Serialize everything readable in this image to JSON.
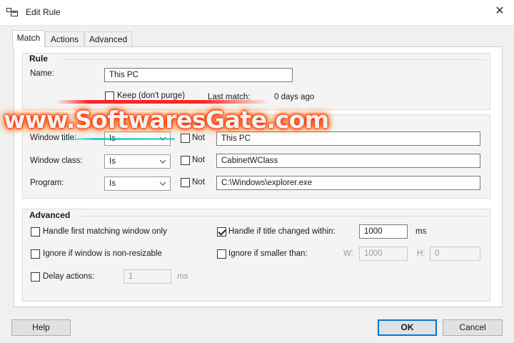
{
  "window": {
    "title": "Edit Rule",
    "close_glyph": "✕"
  },
  "tabs": [
    {
      "label": "Match",
      "active": true
    },
    {
      "label": "Actions",
      "active": false
    },
    {
      "label": "Advanced",
      "active": false
    }
  ],
  "rule": {
    "title": "Rule",
    "name_label": "Name:",
    "name_value": "This PC",
    "keep_label": "Keep (don't purge)",
    "keep_checked": false,
    "last_match_label": "Last match:",
    "last_match_value": "0 days ago"
  },
  "match_rows": [
    {
      "label": "Window title:",
      "operator": "Is",
      "not_label": "Not",
      "not_checked": false,
      "value": "This PC"
    },
    {
      "label": "Window class:",
      "operator": "Is",
      "not_label": "Not",
      "not_checked": false,
      "value": "CabinetWClass"
    },
    {
      "label": "Program:",
      "operator": "Is",
      "not_label": "Not",
      "not_checked": false,
      "value": "C:\\Windows\\explorer.exe"
    }
  ],
  "advanced": {
    "title": "Advanced",
    "first_matching_label": "Handle first matching window only",
    "first_matching_checked": false,
    "title_changed_label": "Handle if title changed within:",
    "title_changed_checked": true,
    "title_changed_value": "1000",
    "title_changed_unit": "ms",
    "non_resizable_label": "Ignore if window is non-resizable",
    "non_resizable_checked": false,
    "smaller_than_label": "Ignore if smaller than:",
    "smaller_than_checked": false,
    "w_label": "W:",
    "w_value": "1000",
    "h_label": "H:",
    "h_value": "0",
    "delay_label": "Delay actions:",
    "delay_checked": false,
    "delay_value": "1",
    "delay_unit": "ms"
  },
  "buttons": {
    "help": "Help",
    "ok": "OK",
    "cancel": "Cancel"
  },
  "watermark": "www.SoftwaresGate.com",
  "colors": {
    "accent": "#0078d7",
    "watermark_glow": "#ff2a00"
  }
}
